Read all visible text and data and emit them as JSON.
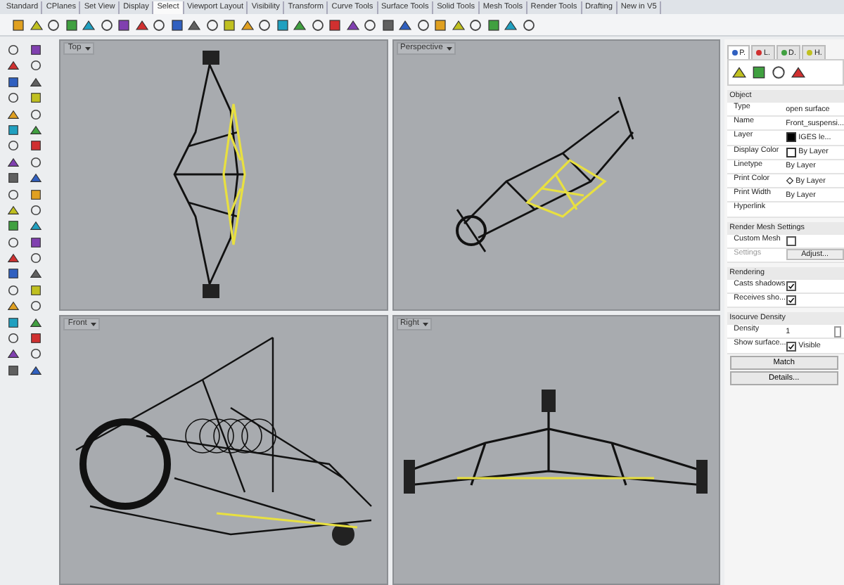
{
  "tabs": [
    {
      "label": "Standard",
      "selected": false
    },
    {
      "label": "CPlanes",
      "selected": false
    },
    {
      "label": "Set View",
      "selected": false
    },
    {
      "label": "Display",
      "selected": false
    },
    {
      "label": "Select",
      "selected": true
    },
    {
      "label": "Viewport Layout",
      "selected": false
    },
    {
      "label": "Visibility",
      "selected": false
    },
    {
      "label": "Transform",
      "selected": false
    },
    {
      "label": "Curve Tools",
      "selected": false
    },
    {
      "label": "Surface Tools",
      "selected": false
    },
    {
      "label": "Solid Tools",
      "selected": false
    },
    {
      "label": "Mesh Tools",
      "selected": false
    },
    {
      "label": "Render Tools",
      "selected": false
    },
    {
      "label": "Drafting",
      "selected": false
    },
    {
      "label": "New in V5",
      "selected": false
    }
  ],
  "viewports": [
    {
      "title": "Top",
      "kind": "top"
    },
    {
      "title": "Perspective",
      "kind": "perspective"
    },
    {
      "title": "Front",
      "kind": "front"
    },
    {
      "title": "Right",
      "kind": "right"
    }
  ],
  "panel": {
    "tabs": [
      {
        "label": "P.",
        "selected": true
      },
      {
        "label": "L.",
        "selected": false
      },
      {
        "label": "D.",
        "selected": false
      },
      {
        "label": "H.",
        "selected": false
      }
    ],
    "sections": [
      {
        "title": "Object",
        "rows": [
          {
            "kind": "text",
            "label": "Type",
            "value": "open surface"
          },
          {
            "kind": "text",
            "label": "Name",
            "value": "Front_suspensi..."
          },
          {
            "kind": "swatch",
            "label": "Layer",
            "value": "IGES le...",
            "color": "#000000"
          },
          {
            "kind": "swatch",
            "label": "Display Color",
            "value": "By Layer",
            "color": "#ffffff"
          },
          {
            "kind": "select",
            "label": "Linetype",
            "value": "By Layer"
          },
          {
            "kind": "print",
            "label": "Print Color",
            "value": "By Layer"
          },
          {
            "kind": "select",
            "label": "Print Width",
            "value": "By Layer"
          },
          {
            "kind": "empty",
            "label": "Hyperlink"
          }
        ]
      },
      {
        "title": "Render Mesh Settings",
        "rows": [
          {
            "kind": "check",
            "label": "Custom Mesh",
            "checked": false
          },
          {
            "kind": "button",
            "label": "Settings",
            "value": "Adjust...",
            "disabled": true
          }
        ]
      },
      {
        "title": "Rendering",
        "rows": [
          {
            "kind": "check",
            "label": "Casts shadows",
            "checked": true
          },
          {
            "kind": "check",
            "label": "Receives sho...",
            "checked": true
          }
        ]
      },
      {
        "title": "Isocurve Density",
        "rows": [
          {
            "kind": "spin",
            "label": "Density",
            "value": "1"
          },
          {
            "kind": "check",
            "label": "Show surface...",
            "checked": true,
            "value": "Visible"
          }
        ]
      }
    ],
    "buttons": [
      "Match",
      "Details..."
    ]
  }
}
